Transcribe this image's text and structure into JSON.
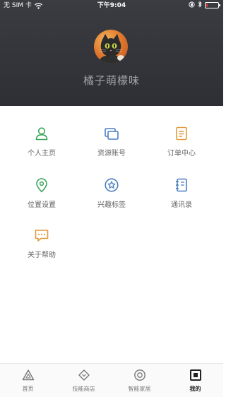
{
  "status_bar": {
    "carrier": "无 SIM 卡",
    "time": "下午9:04",
    "battery_level": 0.12
  },
  "profile": {
    "username": "橘子萌檬味"
  },
  "menu": [
    {
      "label": "个人主页",
      "icon": "person-icon",
      "color": "#3aa55a"
    },
    {
      "label": "资源账号",
      "icon": "cards-icon",
      "color": "#4a7fc1"
    },
    {
      "label": "订单中心",
      "icon": "order-doc-icon",
      "color": "#e39a3c"
    },
    {
      "label": "位置设置",
      "icon": "location-pin-icon",
      "color": "#3aa55a"
    },
    {
      "label": "兴趣标签",
      "icon": "star-badge-icon",
      "color": "#4a7fc1"
    },
    {
      "label": "通讯录",
      "icon": "address-book-icon",
      "color": "#4a7fc1"
    },
    {
      "label": "关于帮助",
      "icon": "chat-bubble-icon",
      "color": "#e39a3c"
    }
  ],
  "tabs": [
    {
      "label": "首页",
      "icon": "home-triangle-icon"
    },
    {
      "label": "技能商店",
      "icon": "diamond-shop-icon"
    },
    {
      "label": "智能家居",
      "icon": "smart-home-circle-icon"
    },
    {
      "label": "我的",
      "icon": "profile-square-icon",
      "active": true
    }
  ]
}
